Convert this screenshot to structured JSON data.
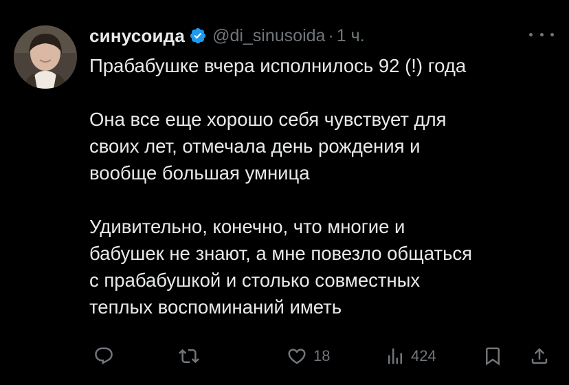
{
  "author": {
    "display_name": "синусоида",
    "handle": "@di_sinusoida",
    "separator": "·",
    "time": "1 ч."
  },
  "tweet": {
    "paragraphs": [
      [
        "Прабабушке вчера исполнилось 92 (!) года"
      ],
      [
        "Она все еще хорошо себя чувствует для",
        "своих лет, отмечала день рождения и",
        "вообще большая умница"
      ],
      [
        "Удивительно, конечно, что многие и",
        "бабушек не знают, а мне повезло общаться",
        "с прабабушкой и столько совместных",
        "теплых воспоминаний иметь"
      ]
    ]
  },
  "actions": {
    "reply_icon": "reply-icon",
    "retweet_icon": "retweet-icon",
    "like_icon": "like-icon",
    "like_count": "18",
    "views_icon": "views-icon",
    "views_count": "424",
    "bookmark_icon": "bookmark-icon",
    "share_icon": "share-icon"
  },
  "colors": {
    "background": "#000000",
    "text": "#e7e9ea",
    "muted": "#71767b",
    "verified": "#1d9bf0"
  }
}
